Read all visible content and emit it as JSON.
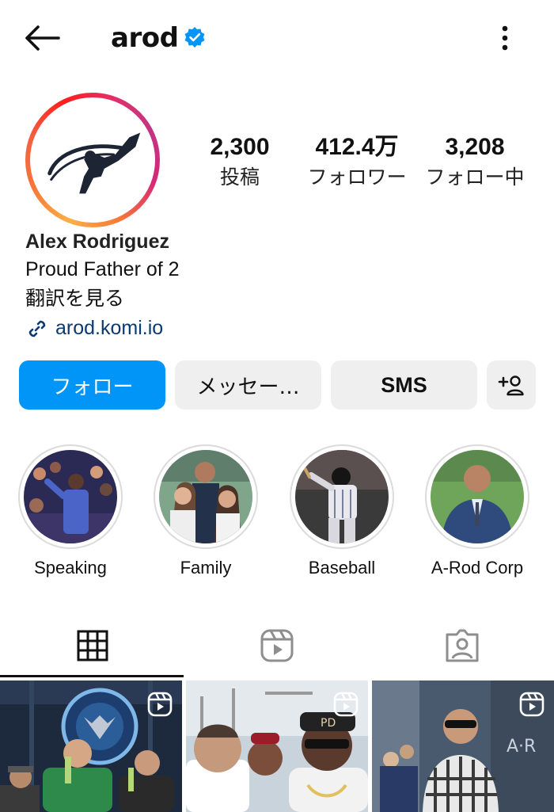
{
  "header": {
    "username": "arod",
    "back_icon": "arrow-left-icon",
    "verified_icon": "verified-badge-icon",
    "more_icon": "more-vertical-icon"
  },
  "profile": {
    "stats": [
      {
        "value": "2,300",
        "label": "投稿"
      },
      {
        "value": "412.4万",
        "label": "フォロワー"
      },
      {
        "value": "3,208",
        "label": "フォロー中"
      }
    ],
    "name": "Alex Rodriguez",
    "bio": "Proud Father of 2",
    "translate": "翻訳を見る",
    "link": "arod.komi.io",
    "story_ring_colors": [
      "#fcaf45",
      "#fd1d1d",
      "#c13584"
    ]
  },
  "actions": {
    "follow": "フォロー",
    "message": "メッセー…",
    "sms": "SMS",
    "add_user_icon": "add-person-icon"
  },
  "highlights": [
    {
      "label": "Speaking"
    },
    {
      "label": "Family"
    },
    {
      "label": "Baseball"
    },
    {
      "label": "A-Rod Corp"
    }
  ],
  "tabs": [
    {
      "icon": "grid-icon",
      "active": true
    },
    {
      "icon": "reels-icon",
      "active": false
    },
    {
      "icon": "tagged-icon",
      "active": false
    }
  ],
  "colors": {
    "accent": "#0095f6",
    "verified": "#0095f6",
    "link": "#0b3a73",
    "button_bg": "#efefef"
  }
}
